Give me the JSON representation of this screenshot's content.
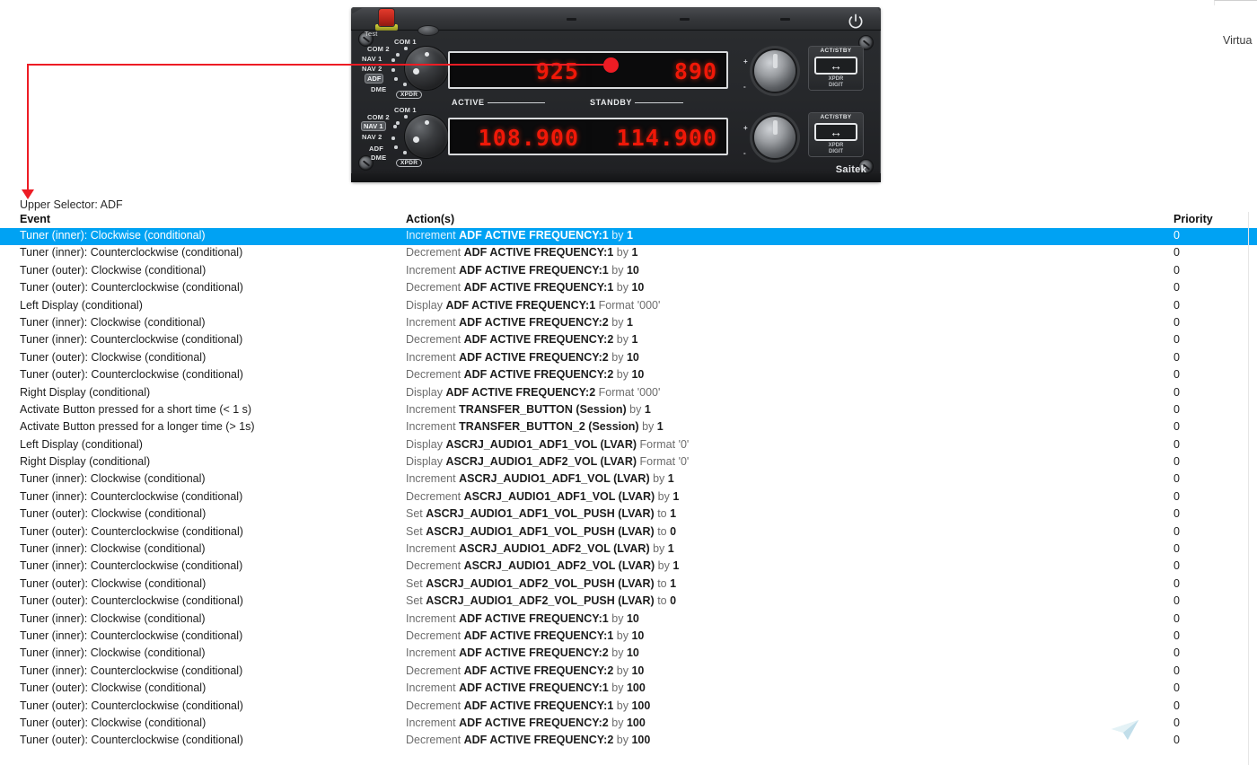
{
  "window": {
    "right_partial_label": "Virtua"
  },
  "device": {
    "brand": "Saitek",
    "test_label": "Test",
    "upper_selector": {
      "options": [
        "COM 2",
        "COM 1",
        "NAV 1",
        "NAV 2",
        "ADF",
        "DME",
        "XPDR"
      ],
      "selected": "ADF"
    },
    "lower_selector": {
      "options": [
        "COM 2",
        "COM 1",
        "NAV 1",
        "NAV 2",
        "ADF",
        "DME",
        "XPDR"
      ],
      "selected": "NAV 1"
    },
    "displays": {
      "top_active": "925",
      "top_standby": "890",
      "bottom_active": "108.900",
      "bottom_standby": "114.900",
      "active_label": "ACTIVE",
      "standby_label": "STANDBY"
    },
    "transfer_buttons": [
      {
        "top": "ACT/STBY",
        "glyph": "↔",
        "sub1": "XPDR",
        "sub2": "DIGIT"
      },
      {
        "top": "ACT/STBY",
        "glyph": "↔",
        "sub1": "XPDR",
        "sub2": "DIGIT"
      }
    ],
    "knob_marks": {
      "plus": "+",
      "minus": "-"
    },
    "power_icon": "power-icon"
  },
  "annotation": {
    "caption": "Upper Selector: ADF",
    "arrow_color": "#ed1c24",
    "target_display": "top_standby"
  },
  "table": {
    "headers": {
      "event": "Event",
      "action": "Action(s)",
      "priority": "Priority"
    },
    "selected_row_index": 0,
    "selection_color": "#00a2f3",
    "rows": [
      {
        "event": "Tuner (inner): Clockwise (conditional)",
        "verb": "Increment",
        "target": "ADF ACTIVE FREQUENCY:1",
        "conn": "by",
        "value": "1",
        "priority": "0"
      },
      {
        "event": "Tuner (inner): Counterclockwise (conditional)",
        "verb": "Decrement",
        "target": "ADF ACTIVE FREQUENCY:1",
        "conn": "by",
        "value": "1",
        "priority": "0"
      },
      {
        "event": "Tuner (outer): Clockwise (conditional)",
        "verb": "Increment",
        "target": "ADF ACTIVE FREQUENCY:1",
        "conn": "by",
        "value": "10",
        "priority": "0"
      },
      {
        "event": "Tuner (outer): Counterclockwise (conditional)",
        "verb": "Decrement",
        "target": "ADF ACTIVE FREQUENCY:1",
        "conn": "by",
        "value": "10",
        "priority": "0"
      },
      {
        "event": "Left Display (conditional)",
        "verb": "Display",
        "target": "ADF ACTIVE FREQUENCY:1",
        "conn": "Format",
        "value": "'000'",
        "value_dim": true,
        "priority": "0"
      },
      {
        "event": "Tuner (inner): Clockwise (conditional)",
        "verb": "Increment",
        "target": "ADF ACTIVE FREQUENCY:2",
        "conn": "by",
        "value": "1",
        "priority": "0"
      },
      {
        "event": "Tuner (inner): Counterclockwise (conditional)",
        "verb": "Decrement",
        "target": "ADF ACTIVE FREQUENCY:2",
        "conn": "by",
        "value": "1",
        "priority": "0"
      },
      {
        "event": "Tuner (outer): Clockwise (conditional)",
        "verb": "Increment",
        "target": "ADF ACTIVE FREQUENCY:2",
        "conn": "by",
        "value": "10",
        "priority": "0"
      },
      {
        "event": "Tuner (outer): Counterclockwise (conditional)",
        "verb": "Decrement",
        "target": "ADF ACTIVE FREQUENCY:2",
        "conn": "by",
        "value": "10",
        "priority": "0"
      },
      {
        "event": "Right Display (conditional)",
        "verb": "Display",
        "target": "ADF ACTIVE FREQUENCY:2",
        "conn": "Format",
        "value": "'000'",
        "value_dim": true,
        "priority": "0"
      },
      {
        "event": "Activate Button pressed for a short time (< 1 s)",
        "verb": "Increment",
        "target": "TRANSFER_BUTTON (Session)",
        "conn": "by",
        "value": "1",
        "priority": "0"
      },
      {
        "event": "Activate Button pressed for a longer time (> 1s)",
        "verb": "Increment",
        "target": "TRANSFER_BUTTON_2 (Session)",
        "conn": "by",
        "value": "1",
        "priority": "0"
      },
      {
        "event": "Left Display (conditional)",
        "verb": "Display",
        "target": "ASCRJ_AUDIO1_ADF1_VOL (LVAR)",
        "conn": "Format",
        "value": "'0'",
        "value_dim": true,
        "priority": "0"
      },
      {
        "event": "Right Display (conditional)",
        "verb": "Display",
        "target": "ASCRJ_AUDIO1_ADF2_VOL (LVAR)",
        "conn": "Format",
        "value": "'0'",
        "value_dim": true,
        "priority": "0"
      },
      {
        "event": "Tuner (inner): Clockwise (conditional)",
        "verb": "Increment",
        "target": "ASCRJ_AUDIO1_ADF1_VOL (LVAR)",
        "conn": "by",
        "value": "1",
        "priority": "0"
      },
      {
        "event": "Tuner (inner): Counterclockwise (conditional)",
        "verb": "Decrement",
        "target": "ASCRJ_AUDIO1_ADF1_VOL (LVAR)",
        "conn": "by",
        "value": "1",
        "priority": "0"
      },
      {
        "event": "Tuner (outer): Clockwise (conditional)",
        "verb": "Set",
        "target": "ASCRJ_AUDIO1_ADF1_VOL_PUSH (LVAR)",
        "conn": "to",
        "value": "1",
        "priority": "0"
      },
      {
        "event": "Tuner (outer): Counterclockwise (conditional)",
        "verb": "Set",
        "target": "ASCRJ_AUDIO1_ADF1_VOL_PUSH (LVAR)",
        "conn": "to",
        "value": "0",
        "priority": "0"
      },
      {
        "event": "Tuner (inner): Clockwise (conditional)",
        "verb": "Increment",
        "target": "ASCRJ_AUDIO1_ADF2_VOL (LVAR)",
        "conn": "by",
        "value": "1",
        "priority": "0"
      },
      {
        "event": "Tuner (inner): Counterclockwise (conditional)",
        "verb": "Decrement",
        "target": "ASCRJ_AUDIO1_ADF2_VOL (LVAR)",
        "conn": "by",
        "value": "1",
        "priority": "0"
      },
      {
        "event": "Tuner (outer): Clockwise (conditional)",
        "verb": "Set",
        "target": "ASCRJ_AUDIO1_ADF2_VOL_PUSH (LVAR)",
        "conn": "to",
        "value": "1",
        "priority": "0"
      },
      {
        "event": "Tuner (outer): Counterclockwise (conditional)",
        "verb": "Set",
        "target": "ASCRJ_AUDIO1_ADF2_VOL_PUSH (LVAR)",
        "conn": "to",
        "value": "0",
        "priority": "0"
      },
      {
        "event": "Tuner (inner): Clockwise (conditional)",
        "verb": "Increment",
        "target": "ADF ACTIVE FREQUENCY:1",
        "conn": "by",
        "value": "10",
        "priority": "0"
      },
      {
        "event": "Tuner (inner): Counterclockwise (conditional)",
        "verb": "Decrement",
        "target": "ADF ACTIVE FREQUENCY:1",
        "conn": "by",
        "value": "10",
        "priority": "0"
      },
      {
        "event": "Tuner (inner): Clockwise (conditional)",
        "verb": "Increment",
        "target": "ADF ACTIVE FREQUENCY:2",
        "conn": "by",
        "value": "10",
        "priority": "0"
      },
      {
        "event": "Tuner (inner): Counterclockwise (conditional)",
        "verb": "Decrement",
        "target": "ADF ACTIVE FREQUENCY:2",
        "conn": "by",
        "value": "10",
        "priority": "0"
      },
      {
        "event": "Tuner (outer): Clockwise (conditional)",
        "verb": "Increment",
        "target": "ADF ACTIVE FREQUENCY:1",
        "conn": "by",
        "value": "100",
        "priority": "0"
      },
      {
        "event": "Tuner (outer): Counterclockwise (conditional)",
        "verb": "Decrement",
        "target": "ADF ACTIVE FREQUENCY:1",
        "conn": "by",
        "value": "100",
        "priority": "0"
      },
      {
        "event": "Tuner (outer): Clockwise (conditional)",
        "verb": "Increment",
        "target": "ADF ACTIVE FREQUENCY:2",
        "conn": "by",
        "value": "100",
        "priority": "0"
      },
      {
        "event": "Tuner (outer): Counterclockwise (conditional)",
        "verb": "Decrement",
        "target": "ADF ACTIVE FREQUENCY:2",
        "conn": "by",
        "value": "100",
        "priority": "0"
      }
    ]
  },
  "watermark": {
    "icon": "paper-plane-icon"
  }
}
